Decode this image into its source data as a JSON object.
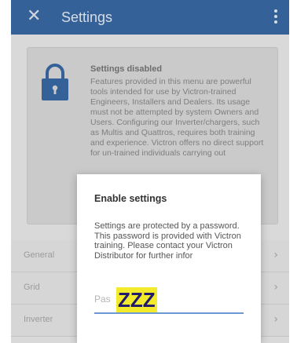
{
  "appbar": {
    "close_icon": "close-icon",
    "title": "Settings",
    "menu_icon": "overflow-menu-icon"
  },
  "card": {
    "icon": "lock-icon",
    "heading": "Settings disabled",
    "body": "Features provided in this menu are powerful tools intended for use by Victron-trained Engineers, Installers and Dealers. Its usage must not be attempted by system Owners and Users. Configuring our Inverter/chargers, such as Multis and Quattros, requires both training and experience. Victron offers no direct support for un-trained individuals carrying out"
  },
  "list": {
    "items": [
      {
        "label": "General"
      },
      {
        "label": "Grid"
      },
      {
        "label": "Inverter"
      }
    ]
  },
  "dialog": {
    "title": "Enable settings",
    "message": "Settings are protected by a password. This password is provided with Victron training. Please contact your Victron Distributor for further infor",
    "password_placeholder": "Pas",
    "password_value": "ZZZ"
  },
  "colors": {
    "appbar": "#3a6aa6",
    "accent": "#6c99d4",
    "highlight": "#f3ea2c"
  }
}
